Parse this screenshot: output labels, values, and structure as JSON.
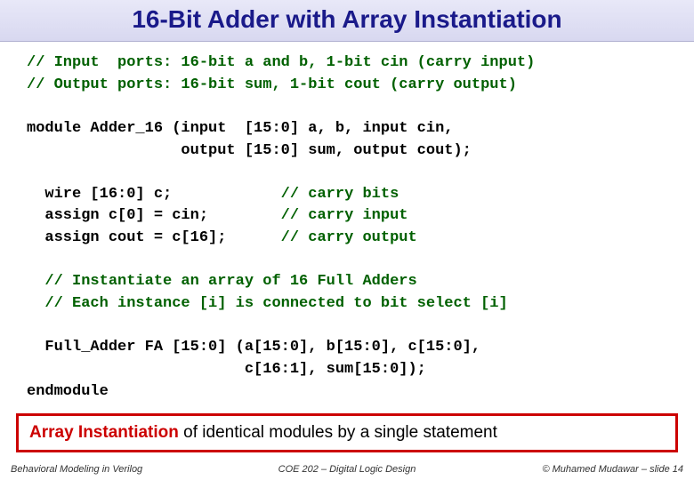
{
  "title": "16-Bit Adder with Array Instantiation",
  "code": {
    "c1": "// Input  ports: 16-bit a and b, 1-bit cin (carry input)",
    "c2": "// Output ports: 16-bit sum, 1-bit cout (carry output)",
    "l1": "module Adder_16 (input  [15:0] a, b, input cin,",
    "l2": "                 output [15:0] sum, output cout);",
    "l3a": "  wire [16:0] c;            ",
    "l3b": "// carry bits",
    "l4a": "  assign c[0] = cin;        ",
    "l4b": "// carry input",
    "l5a": "  assign cout = c[16];      ",
    "l5b": "// carry output",
    "c3": "  // Instantiate an array of 16 Full Adders",
    "c4": "  // Each instance [i] is connected to bit select [i]",
    "l6": "  Full_Adder FA [15:0] (a[15:0], b[15:0], c[15:0],",
    "l7": "                        c[16:1], sum[15:0]);",
    "l8": "endmodule"
  },
  "callout": {
    "phrase": "Array Instantiation",
    "rest": " of identical modules by a single statement"
  },
  "footer": {
    "left": "Behavioral Modeling in Verilog",
    "center": "COE 202 – Digital Logic Design",
    "right": "© Muhamed Mudawar – slide 14"
  }
}
